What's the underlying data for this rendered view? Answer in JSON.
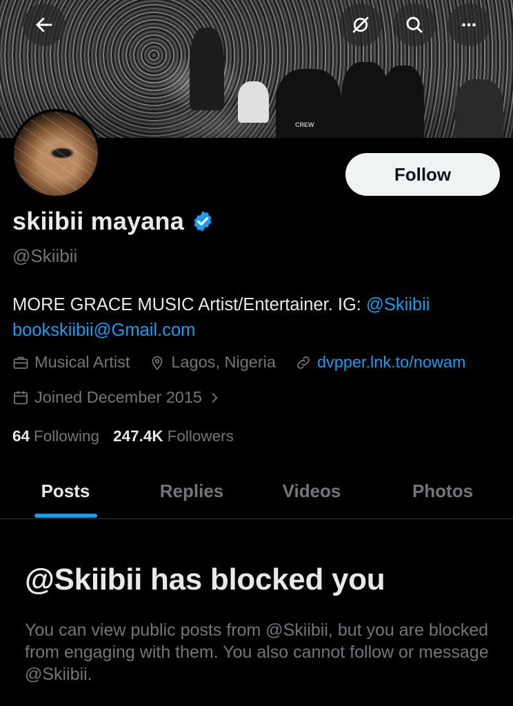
{
  "header": {
    "back_icon": "arrow-left-icon",
    "grok_icon": "grok-icon",
    "search_icon": "search-icon",
    "more_icon": "more-icon"
  },
  "banner": {
    "shirt_text": "CREW"
  },
  "profile": {
    "display_name": "skiibii mayana",
    "handle": "@Skiibii",
    "verified": true,
    "follow_label": "Follow",
    "bio_text": "MORE GRACE MUSIC Artist/Entertainer. IG: ",
    "bio_ig": "@Skiibii",
    "bio_email": "bookskiibii@Gmail.com",
    "category": "Musical Artist",
    "location": "Lagos, Nigeria",
    "website": "dvpper.lnk.to/nowam",
    "joined": "Joined December 2015",
    "following_count": "64",
    "following_label": "Following",
    "followers_count": "247.4K",
    "followers_label": "Followers"
  },
  "tabs": [
    {
      "label": "Posts",
      "active": true
    },
    {
      "label": "Replies",
      "active": false
    },
    {
      "label": "Videos",
      "active": false
    },
    {
      "label": "Photos",
      "active": false
    }
  ],
  "blocked": {
    "title": "@Skiibii has blocked you",
    "description": "You can view public posts from @Skiibii, but you are blocked from engaging with them. You also cannot follow or message @Skiibii."
  },
  "colors": {
    "background": "#000000",
    "accent": "#1d9bf0",
    "muted": "#71767b",
    "text": "#e7e9ea"
  }
}
